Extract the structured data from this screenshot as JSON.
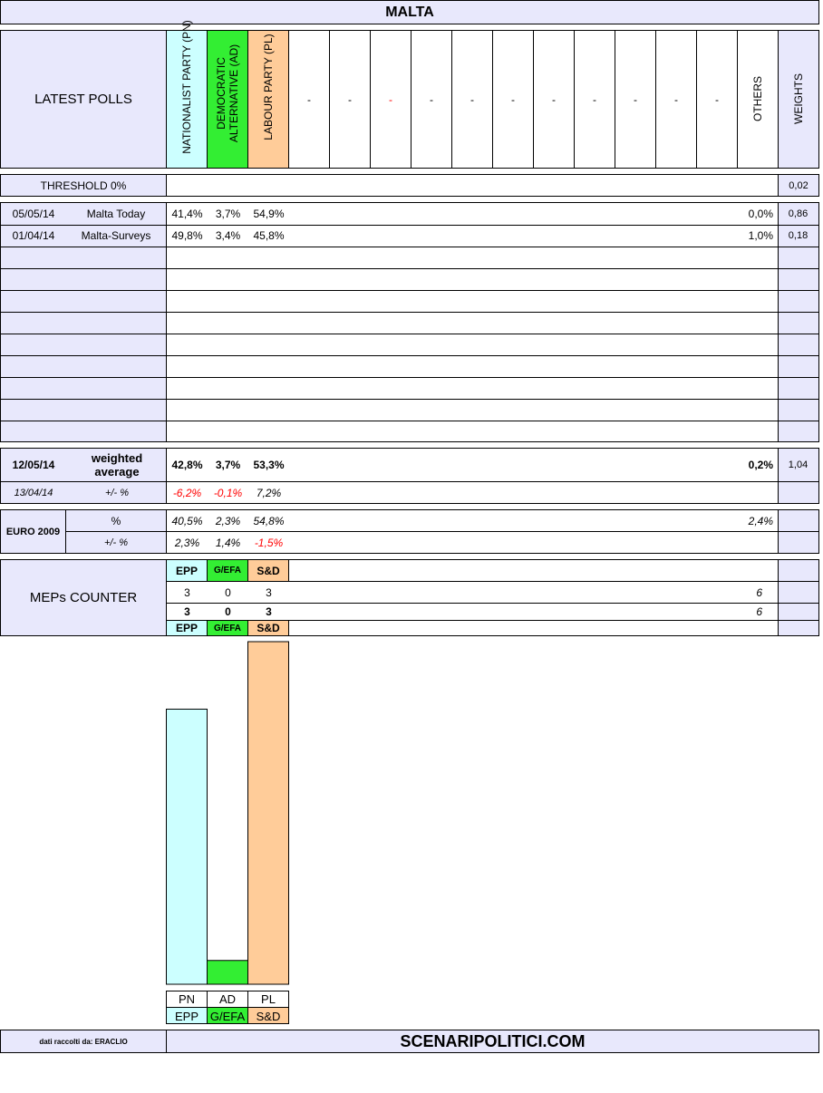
{
  "title": "MALTA",
  "header": {
    "latest_polls": "LATEST POLLS",
    "parties": [
      {
        "name": "NATIONALIST PARTY (PN)",
        "color": "#ccffff"
      },
      {
        "name": "DEMOCRATIC ALTERNATIVE (AD)",
        "color": "#33ee33"
      },
      {
        "name": "LABOUR PARTY (PL)",
        "color": "#ffcc99"
      }
    ],
    "placeholder_cols": [
      "-",
      "-",
      "-",
      "-",
      "-",
      "-",
      "-",
      "-",
      "-",
      "-",
      "-"
    ],
    "others": "OTHERS",
    "weights": "WEIGHTS"
  },
  "threshold": {
    "label": "THRESHOLD 0%",
    "weight": "0,02"
  },
  "polls": [
    {
      "date": "05/05/14",
      "pollster": "Malta Today",
      "values": [
        "41,4%",
        "3,7%",
        "54,9%"
      ],
      "others": "0,0%",
      "weight": "0,86"
    },
    {
      "date": "01/04/14",
      "pollster": "Malta-Surveys",
      "values": [
        "49,8%",
        "3,4%",
        "45,8%"
      ],
      "others": "1,0%",
      "weight": "0,18"
    }
  ],
  "weighted": {
    "date": "12/05/14",
    "label": "weighted average",
    "values": [
      "42,8%",
      "3,7%",
      "53,3%"
    ],
    "others": "0,2%",
    "weight": "1,04",
    "prev_date": "13/04/14",
    "diff_label": "+/- %",
    "diffs": [
      "-6,2%",
      "-0,1%",
      "7,2%"
    ]
  },
  "euro2009": {
    "label": "EURO 2009",
    "pct_label": "%",
    "diff_label": "+/- %",
    "values": [
      "40,5%",
      "2,3%",
      "54,8%"
    ],
    "others": "2,4%",
    "diffs": [
      "2,3%",
      "1,4%",
      "-1,5%"
    ]
  },
  "meps": {
    "label": "MEPs COUNTER",
    "groups": [
      "EPP",
      "G/EFA",
      "S&D"
    ],
    "row1": [
      "3",
      "0",
      "3"
    ],
    "total1": "6",
    "row2": [
      "3",
      "0",
      "3"
    ],
    "total2": "6"
  },
  "chart_data": {
    "type": "bar",
    "categories": [
      "PN",
      "AD",
      "PL"
    ],
    "groups": [
      "EPP",
      "G/EFA",
      "S&D"
    ],
    "values": [
      42.8,
      3.7,
      53.3
    ],
    "colors": [
      "#ccffff",
      "#33ee33",
      "#ffcc99"
    ]
  },
  "footer": {
    "credit": "dati raccolti da: ERACLIO",
    "site": "SCENARIPOLITICI.COM"
  }
}
